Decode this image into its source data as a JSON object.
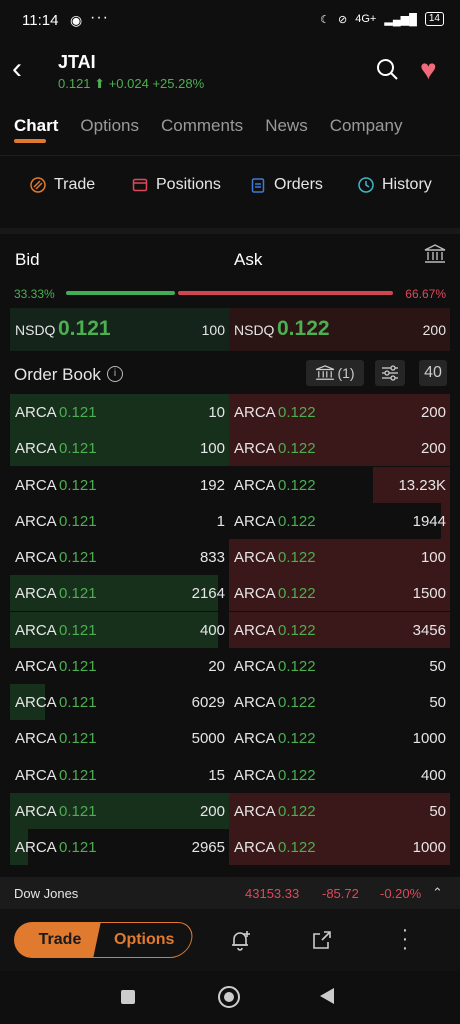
{
  "status": {
    "time": "11:14",
    "icons": [
      "whatsapp-icon",
      "more-dots-icon",
      "moon-icon",
      "mute-icon",
      "4g-icon",
      "signal-icon"
    ],
    "battery": "14"
  },
  "header": {
    "ticker": "JTAI",
    "price": "0.121",
    "change": "+0.024",
    "pct": "+25.28%"
  },
  "tabs": [
    "Chart",
    "Options",
    "Comments",
    "News",
    "Company"
  ],
  "actions": {
    "trade": "Trade",
    "positions": "Positions",
    "orders": "Orders",
    "history": "History"
  },
  "bidask": {
    "bid_label": "Bid",
    "ask_label": "Ask",
    "bid_pct": "33.33%",
    "ask_pct": "66.67%",
    "bid_share": 0.3333,
    "bid_ex": "NSDQ",
    "bid_price": "0.121",
    "bid_size": "100",
    "ask_ex": "NSDQ",
    "ask_price": "0.122",
    "ask_size": "200"
  },
  "orderbook": {
    "label": "Order Book",
    "venue_count": "(1)",
    "depth": "40",
    "bids": [
      {
        "ex": "ARCA",
        "price": "0.121",
        "size": "10",
        "fill": 1.0
      },
      {
        "ex": "ARCA",
        "price": "0.121",
        "size": "100",
        "fill": 1.0
      },
      {
        "ex": "ARCA",
        "price": "0.121",
        "size": "192",
        "fill": 0.0
      },
      {
        "ex": "ARCA",
        "price": "0.121",
        "size": "1",
        "fill": 0.0
      },
      {
        "ex": "ARCA",
        "price": "0.121",
        "size": "833",
        "fill": 0.0
      },
      {
        "ex": "ARCA",
        "price": "0.121",
        "size": "2164",
        "fill": 0.95
      },
      {
        "ex": "ARCA",
        "price": "0.121",
        "size": "400",
        "fill": 0.95
      },
      {
        "ex": "ARCA",
        "price": "0.121",
        "size": "20",
        "fill": 0.0
      },
      {
        "ex": "ARCA",
        "price": "0.121",
        "size": "6029",
        "fill": 0.16
      },
      {
        "ex": "ARCA",
        "price": "0.121",
        "size": "5000",
        "fill": 0.0
      },
      {
        "ex": "ARCA",
        "price": "0.121",
        "size": "15",
        "fill": 0.0
      },
      {
        "ex": "ARCA",
        "price": "0.121",
        "size": "200",
        "fill": 1.0
      },
      {
        "ex": "ARCA",
        "price": "0.121",
        "size": "2965",
        "fill": 0.08
      }
    ],
    "asks": [
      {
        "ex": "ARCA",
        "price": "0.122",
        "size": "200",
        "fill": 1.0
      },
      {
        "ex": "ARCA",
        "price": "0.122",
        "size": "200",
        "fill": 1.0
      },
      {
        "ex": "ARCA",
        "price": "0.122",
        "size": "13.23K",
        "fill": 0.35
      },
      {
        "ex": "ARCA",
        "price": "0.122",
        "size": "1944",
        "fill": 0.04
      },
      {
        "ex": "ARCA",
        "price": "0.122",
        "size": "100",
        "fill": 1.0
      },
      {
        "ex": "ARCA",
        "price": "0.122",
        "size": "1500",
        "fill": 1.0
      },
      {
        "ex": "ARCA",
        "price": "0.122",
        "size": "3456",
        "fill": 1.0
      },
      {
        "ex": "ARCA",
        "price": "0.122",
        "size": "50",
        "fill": 0.0
      },
      {
        "ex": "ARCA",
        "price": "0.122",
        "size": "50",
        "fill": 0.0
      },
      {
        "ex": "ARCA",
        "price": "0.122",
        "size": "1000",
        "fill": 0.0
      },
      {
        "ex": "ARCA",
        "price": "0.122",
        "size": "400",
        "fill": 0.0
      },
      {
        "ex": "ARCA",
        "price": "0.122",
        "size": "50",
        "fill": 1.0
      },
      {
        "ex": "ARCA",
        "price": "0.122",
        "size": "1000",
        "fill": 1.0
      }
    ]
  },
  "ticker_strip": {
    "name": "Dow Jones",
    "value": "43153.33",
    "change": "-85.72",
    "pct": "-0.20%"
  },
  "bottom": {
    "trade": "Trade",
    "options": "Options"
  },
  "colors": {
    "accent": "#e07a2e",
    "up": "#4caf50",
    "down": "#e0485a"
  }
}
